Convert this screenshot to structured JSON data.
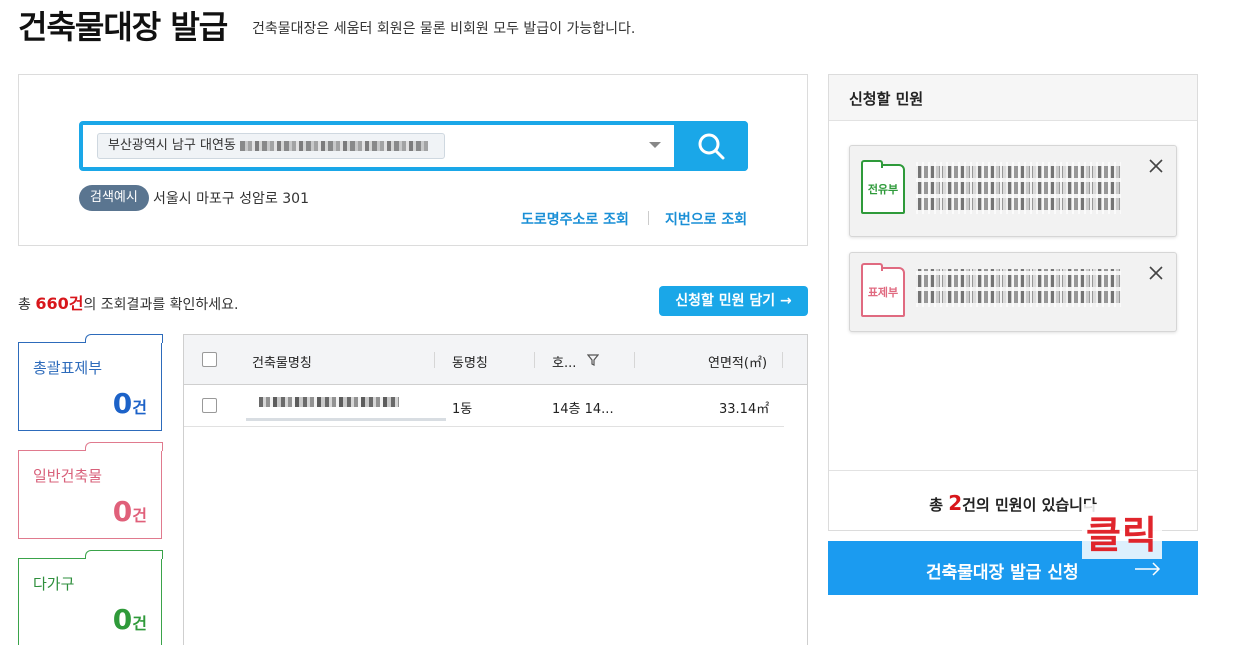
{
  "header": {
    "title": "건축물대장 발급",
    "subtitle": "건축물대장은 세움터 회원은 물론 비회원 모두 발급이 가능합니다."
  },
  "search": {
    "tag_text": "부산광역시 남구 대연동",
    "example_badge": "검색예시",
    "example_text": "서울시 마포구 성암로 301",
    "link_road": "도로명주소로 조회",
    "link_lot": "지번으로 조회"
  },
  "results": {
    "prefix": "총 ",
    "count": "660건",
    "suffix": "의 조회결과를 확인하세요.",
    "add_button": "신청할 민원 담기 →"
  },
  "categories": [
    {
      "label": "총괄표제부",
      "count": "0",
      "unit": "건",
      "color": "#2d6bbb"
    },
    {
      "label": "일반건축물",
      "count": "0",
      "unit": "건",
      "color": "#e07a8e"
    },
    {
      "label": "다가구",
      "count": "0",
      "unit": "건",
      "color": "#3aa34a"
    }
  ],
  "table": {
    "columns": [
      "건축물명칭",
      "동명칭",
      "호...",
      "연면적(㎡)"
    ],
    "rows": [
      {
        "dong": "1동",
        "ho": "14층 14...",
        "area": "33.14㎡"
      }
    ]
  },
  "request_panel": {
    "title": "신청할 민원",
    "items": [
      {
        "type": "전유부",
        "color": "#2e9a3a"
      },
      {
        "type": "표제부",
        "color": "#e06a80"
      }
    ],
    "footer_prefix": "총 ",
    "footer_count": "2",
    "footer_suffix": "건의 민원이 있습니다"
  },
  "apply_button": {
    "label": "건축물대장 발급 신청",
    "arrow": "→"
  },
  "annotation": {
    "text": "클릭"
  }
}
